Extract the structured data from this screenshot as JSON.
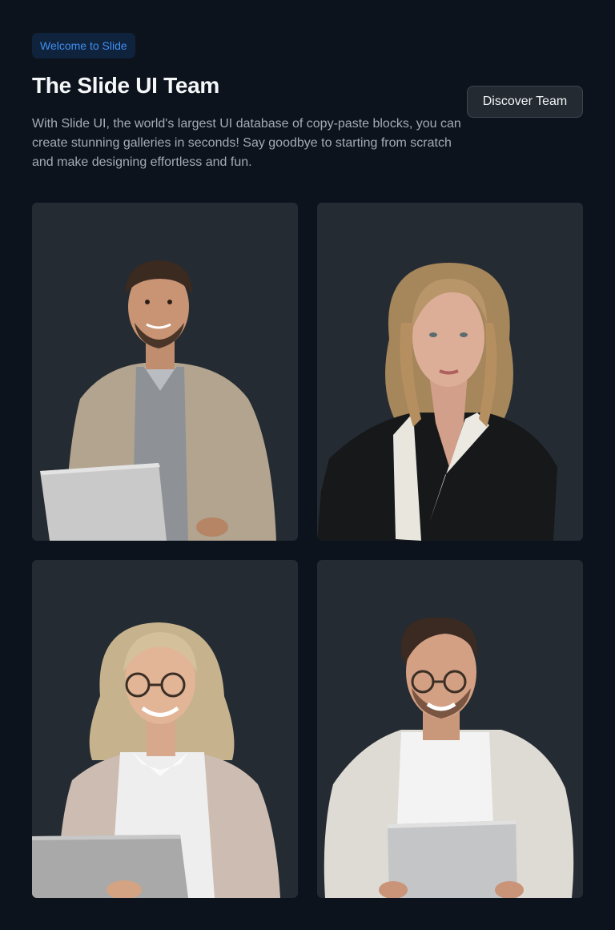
{
  "header": {
    "badge": "Welcome to Slide",
    "title": "The Slide UI Team",
    "description": "With Slide UI, the world's largest UI database of copy-paste blocks, you can create stunning galleries in seconds! Say goodbye to starting from scratch and make designing effortless and fun.",
    "cta_label": "Discover Team"
  }
}
